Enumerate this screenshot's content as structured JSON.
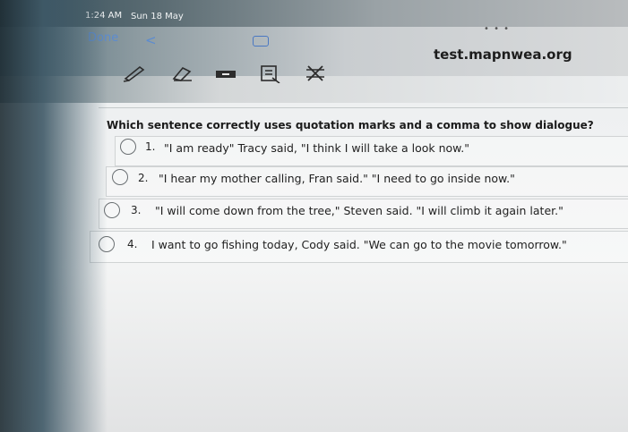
{
  "status": {
    "time": "1:24 AM",
    "date": "Sun 18 May"
  },
  "browser": {
    "done_label": "Done",
    "back_glyph": "<",
    "url": "test.mapnwea.org",
    "more_glyph": "• • •"
  },
  "toolbar": {
    "tools": [
      "pencil-icon",
      "eraser-icon",
      "highlighter-icon",
      "answer-eliminator-icon",
      "cross-out-icon"
    ]
  },
  "question": {
    "prompt": "Which sentence correctly uses quotation marks and a comma to show dialogue?",
    "options": [
      {
        "number": "1.",
        "text": "\"I am ready\" Tracy said, \"I think I will take a look now.\""
      },
      {
        "number": "2.",
        "text": "\"I hear my mother calling, Fran said.\" \"I need to go inside now.\""
      },
      {
        "number": "3.",
        "text": "\"I will come down from the tree,\" Steven said. \"I will climb it again later.\""
      },
      {
        "number": "4.",
        "text": "I want to go fishing today, Cody said. \"We can go to the movie tomorrow.\""
      }
    ]
  },
  "colors": {
    "link": "#5c8cd0",
    "text": "#1f1f1f"
  }
}
